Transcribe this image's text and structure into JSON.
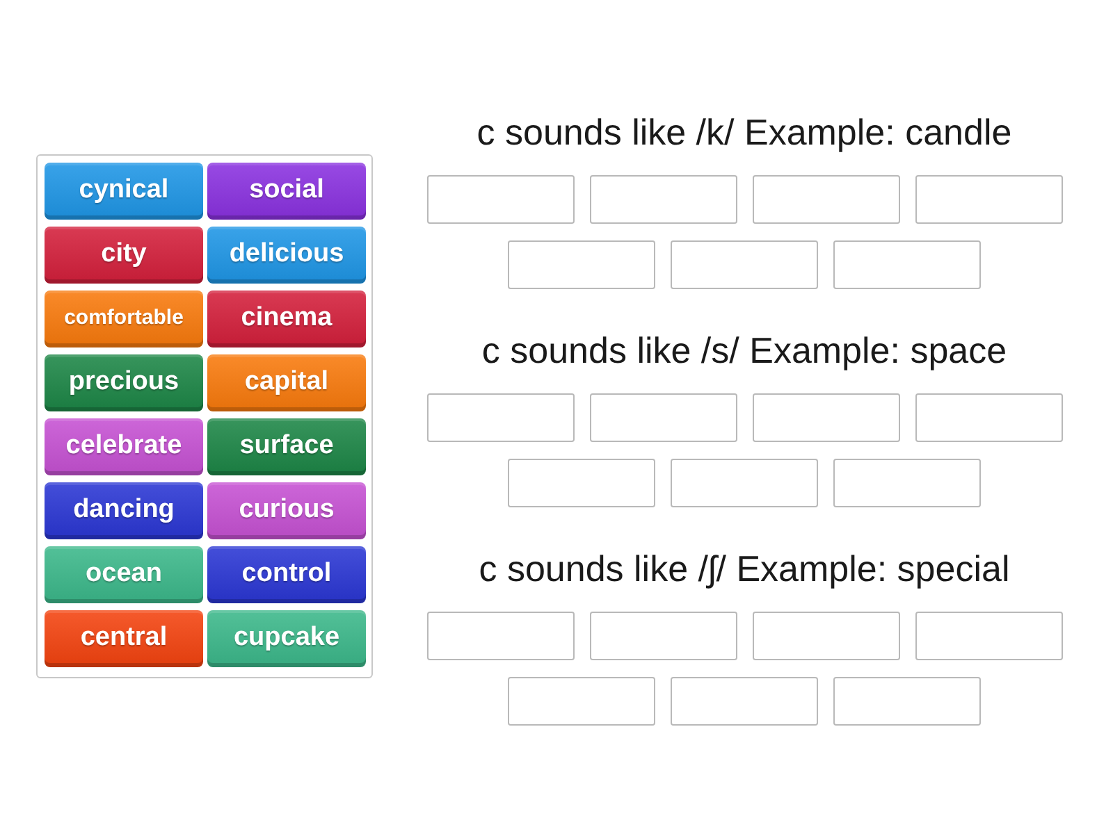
{
  "word_bank": {
    "tiles": [
      {
        "label": "cynical",
        "color": "#1e96e6"
      },
      {
        "label": "social",
        "color": "#8a31e0"
      },
      {
        "label": "city",
        "color": "#d41f3b"
      },
      {
        "label": "delicious",
        "color": "#1e96e6"
      },
      {
        "label": "comfortable",
        "color": "#f97a0c"
      },
      {
        "label": "cinema",
        "color": "#d41f3b"
      },
      {
        "label": "precious",
        "color": "#1c8646"
      },
      {
        "label": "capital",
        "color": "#f97a0c"
      },
      {
        "label": "celebrate",
        "color": "#c651d3"
      },
      {
        "label": "surface",
        "color": "#1c8646"
      },
      {
        "label": "dancing",
        "color": "#2a36d4"
      },
      {
        "label": "curious",
        "color": "#c651d3"
      },
      {
        "label": "ocean",
        "color": "#3bb88a"
      },
      {
        "label": "control",
        "color": "#2a36d4"
      },
      {
        "label": "central",
        "color": "#f4430f"
      },
      {
        "label": "cupcake",
        "color": "#3bb88a"
      }
    ]
  },
  "groups": [
    {
      "title": "c sounds like /k/ Example: candle",
      "answer_boxes": [
        {
          "kind": "blank"
        },
        {
          "kind": "blank"
        },
        {
          "kind": "blank"
        },
        {
          "kind": "blank"
        },
        {
          "kind": "blank"
        },
        {
          "kind": "blank"
        },
        {
          "kind": "blank"
        }
      ]
    },
    {
      "title": "c sounds like /s/ Example: space",
      "answer_boxes": [
        {
          "kind": "blank"
        },
        {
          "kind": "blank"
        },
        {
          "kind": "blank"
        },
        {
          "kind": "blank"
        },
        {
          "kind": "blank"
        },
        {
          "kind": "blank"
        },
        {
          "kind": "blank"
        }
      ]
    },
    {
      "title": "c sounds like /ʃ/ Example: special",
      "answer_boxes": [
        {
          "kind": "blank"
        },
        {
          "kind": "blank"
        },
        {
          "kind": "blank"
        },
        {
          "kind": "blank"
        },
        {
          "kind": "blank"
        },
        {
          "kind": "blank"
        },
        {
          "kind": "blank"
        }
      ]
    }
  ]
}
